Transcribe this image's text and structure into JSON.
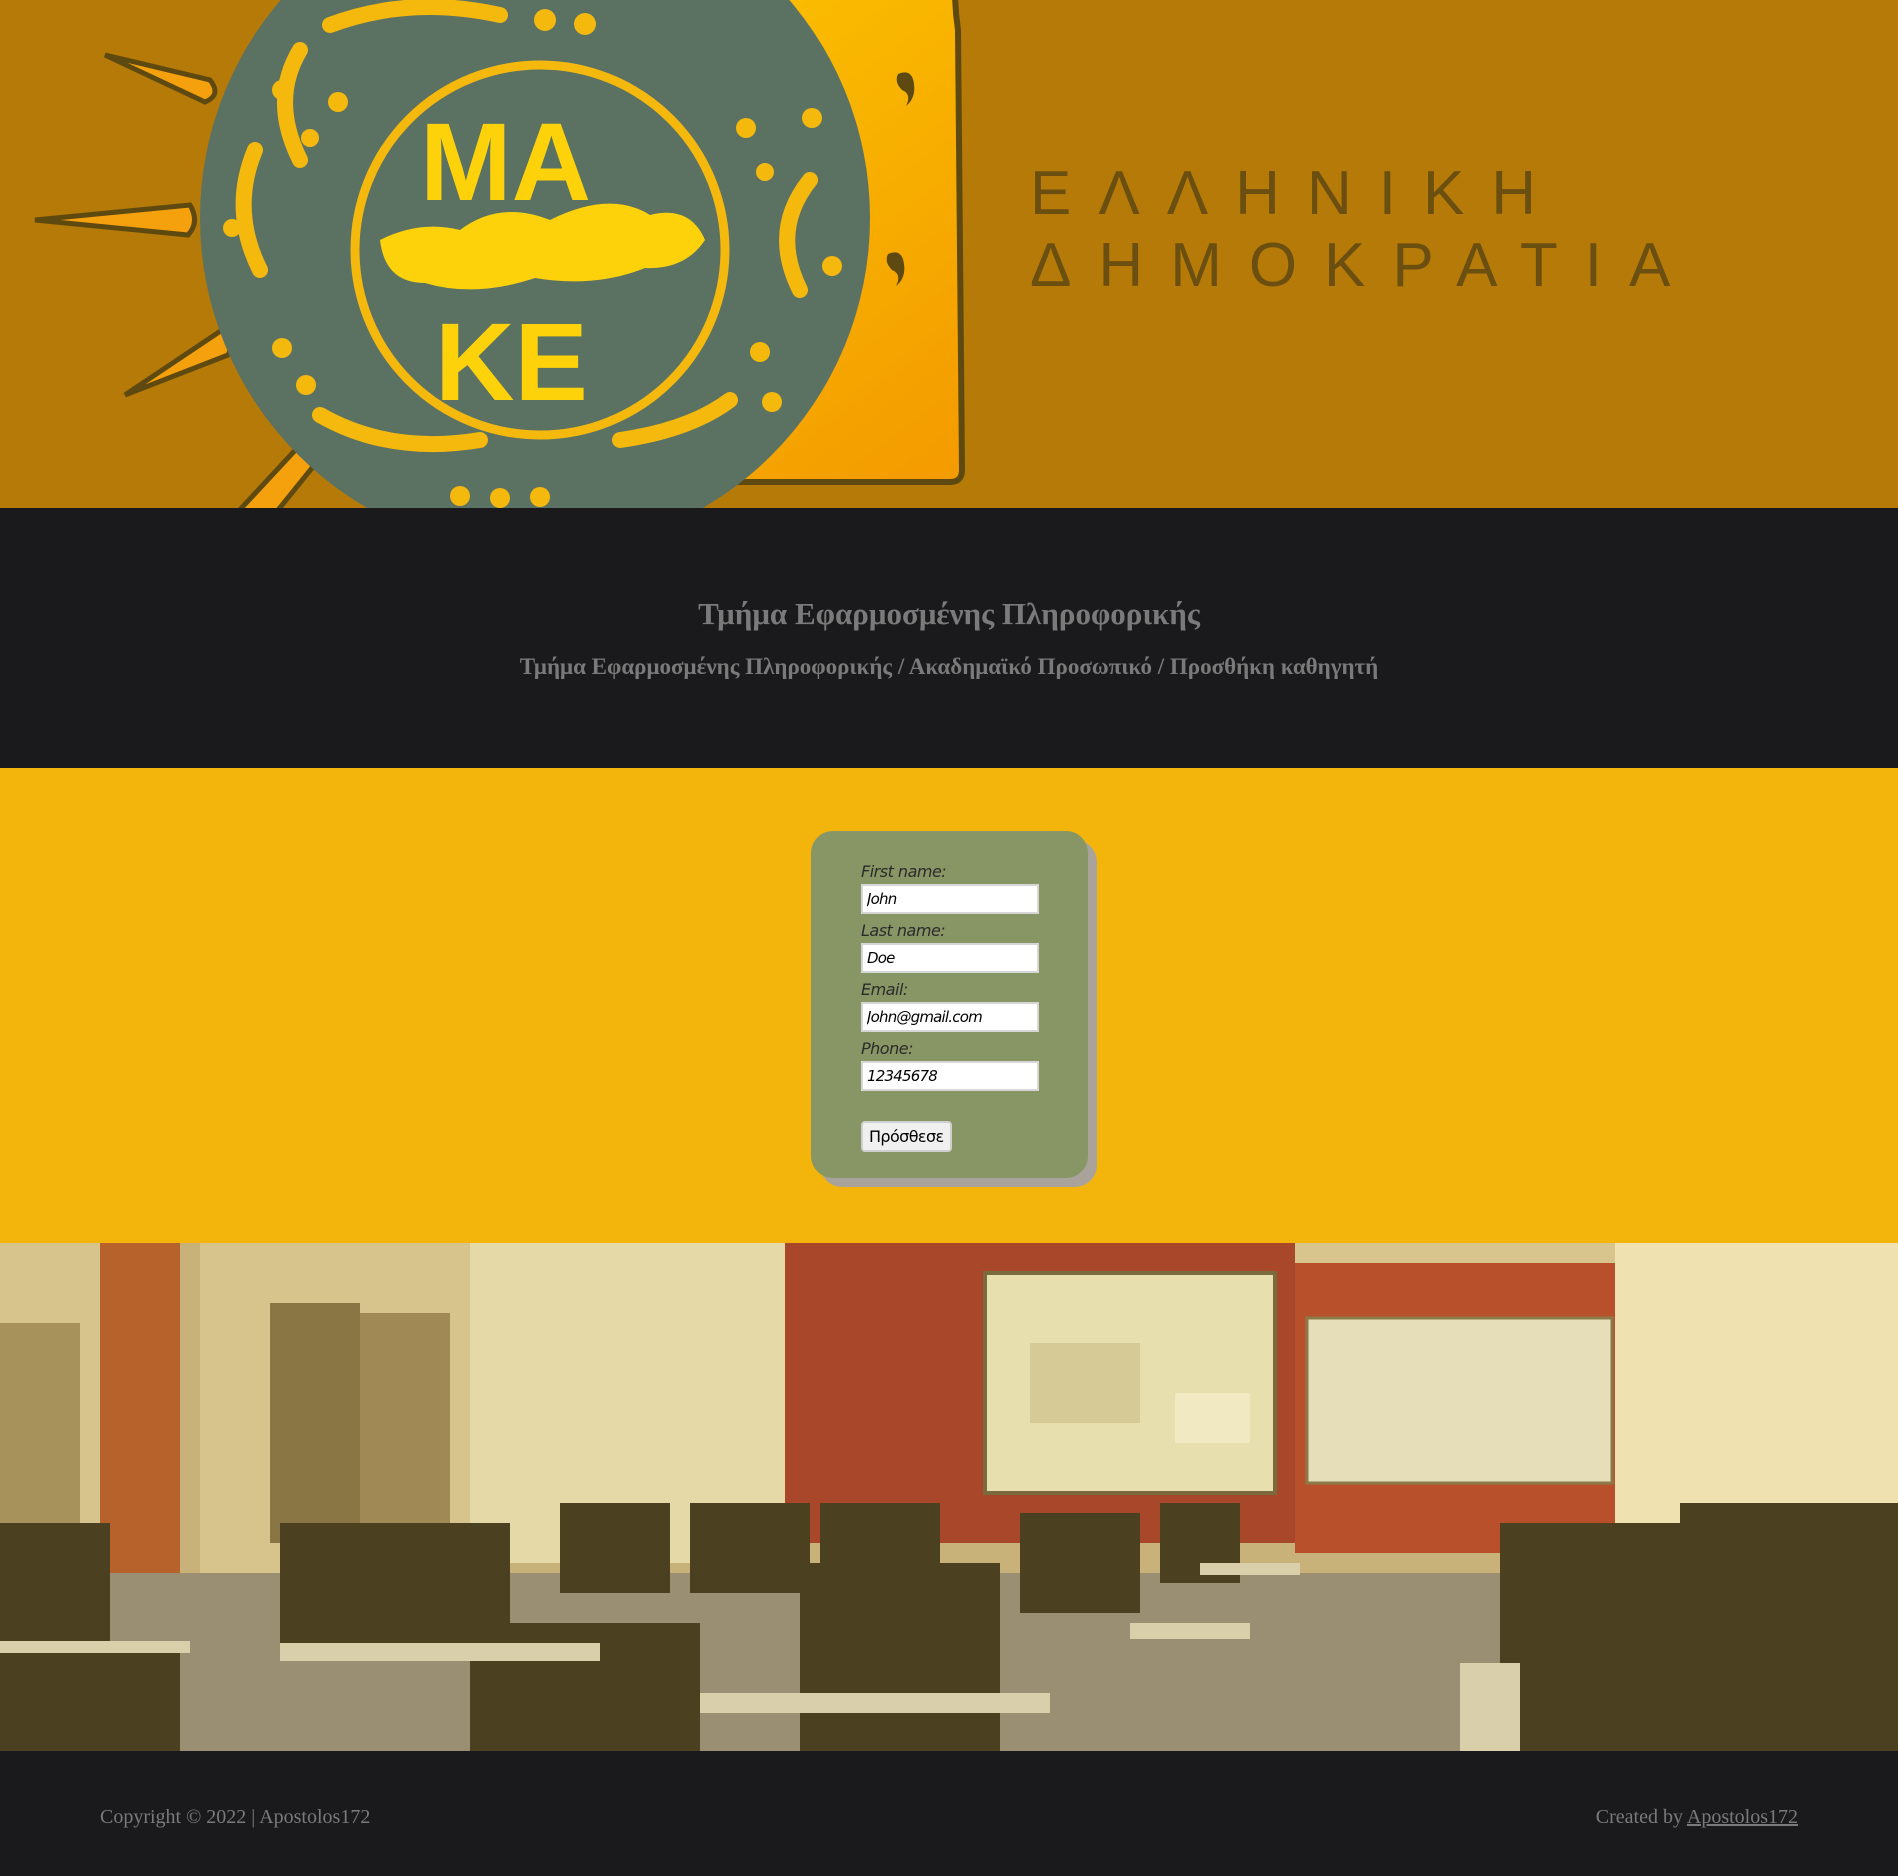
{
  "banner": {
    "country_line1": "ΕΛΛΗΝΙΚΗ",
    "country_line2": "ΔΗΜΟΚΡΑΤΙΑ",
    "logo_letters_top": "ΜΑ",
    "logo_letters_bottom": "ΚΕ"
  },
  "header": {
    "department": "Τμήμα Εφαρμοσμένης Πληροφορικής",
    "breadcrumb": "Τμήμα Εφαρμοσμένης Πληροφορικής / Ακαδημαϊκό Προσωπικό / Προσθήκη καθηγητή"
  },
  "form": {
    "first_name_label": "First name:",
    "first_name_value": "John",
    "last_name_label": "Last name:",
    "last_name_value": "Doe",
    "email_label": "Email:",
    "email_value": "John@gmail.com",
    "phone_label": "Phone:",
    "phone_value": "12345678",
    "submit_label": "Πρόσθεσε"
  },
  "footer": {
    "copyright": "Copyright © 2022 | Apostolos172",
    "created_by": "Created by",
    "author_link": "Apostolos172"
  },
  "colors": {
    "banner_bg": "#b57a08",
    "dark_band": "#1a1a1c",
    "form_band": "#f3b50c",
    "form_card": "#889665",
    "text_gray": "#7a7a7a"
  }
}
